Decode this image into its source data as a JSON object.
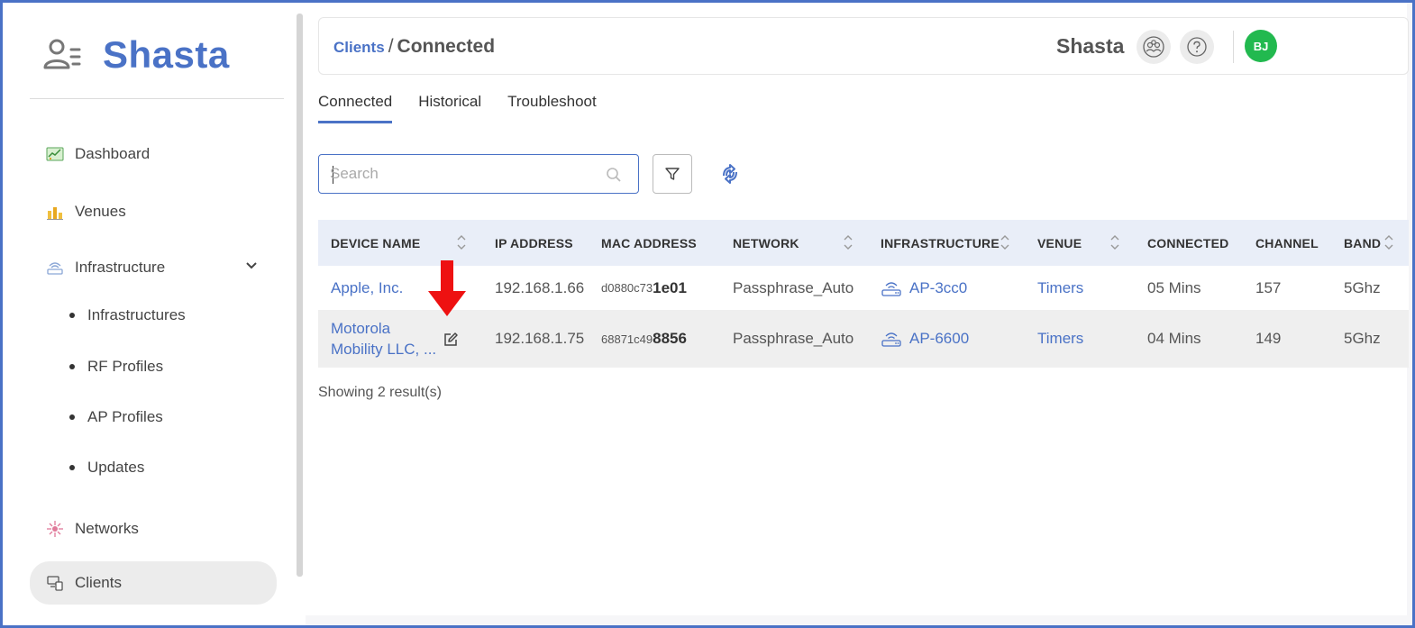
{
  "brand": {
    "name": "Shasta",
    "color": "#4a72c6",
    "icon": "users-icon"
  },
  "sidebar": {
    "items": [
      {
        "label": "Dashboard",
        "icon": "dashboard-icon"
      },
      {
        "label": "Venues",
        "icon": "venues-icon"
      },
      {
        "label": "Infrastructure",
        "icon": "infrastructure-icon"
      },
      {
        "label": "Networks",
        "icon": "networks-icon"
      },
      {
        "label": "Clients",
        "icon": "clients-icon",
        "active": true
      }
    ],
    "sub_items": [
      "Infrastructures",
      "RF Profiles",
      "AP Profiles",
      "Updates"
    ]
  },
  "header": {
    "breadcrumb_link": "Clients",
    "breadcrumb_sep": "/",
    "breadcrumb_current": "Connected",
    "org_name": "Shasta",
    "avatar_initials": "BJ",
    "avatar_color": "#22b94f"
  },
  "tabs": [
    "Connected",
    "Historical",
    "Troubleshoot"
  ],
  "active_tab": "Connected",
  "search": {
    "placeholder": "Search",
    "value": ""
  },
  "table": {
    "columns": [
      "DEVICE NAME",
      "IP ADDRESS",
      "MAC ADDRESS",
      "NETWORK",
      "INFRASTRUCTURE",
      "VENUE",
      "CONNECTED",
      "CHANNEL",
      "BAND"
    ],
    "rows": [
      {
        "device_name": "Apple, Inc.",
        "ip": "192.168.1.66",
        "mac_prefix": "d0880c73",
        "mac_suffix": "1e01",
        "network": "Passphrase_Auto",
        "infrastructure": "AP-3cc0",
        "venue": "Timers",
        "connected": "05 Mins",
        "channel": "157",
        "band": "5Ghz"
      },
      {
        "device_name_line1": "Motorola",
        "device_name_line2": "Mobility LLC, ...",
        "ip": "192.168.1.75",
        "mac_prefix": "68871c49",
        "mac_suffix": "8856",
        "network": "Passphrase_Auto",
        "infrastructure": "AP-6600",
        "venue": "Timers",
        "connected": "04 Mins",
        "channel": "149",
        "band": "5Ghz"
      }
    ]
  },
  "results_text": "Showing 2 result(s)",
  "annotation": {
    "type": "red-arrow",
    "color": "#ee1111"
  }
}
